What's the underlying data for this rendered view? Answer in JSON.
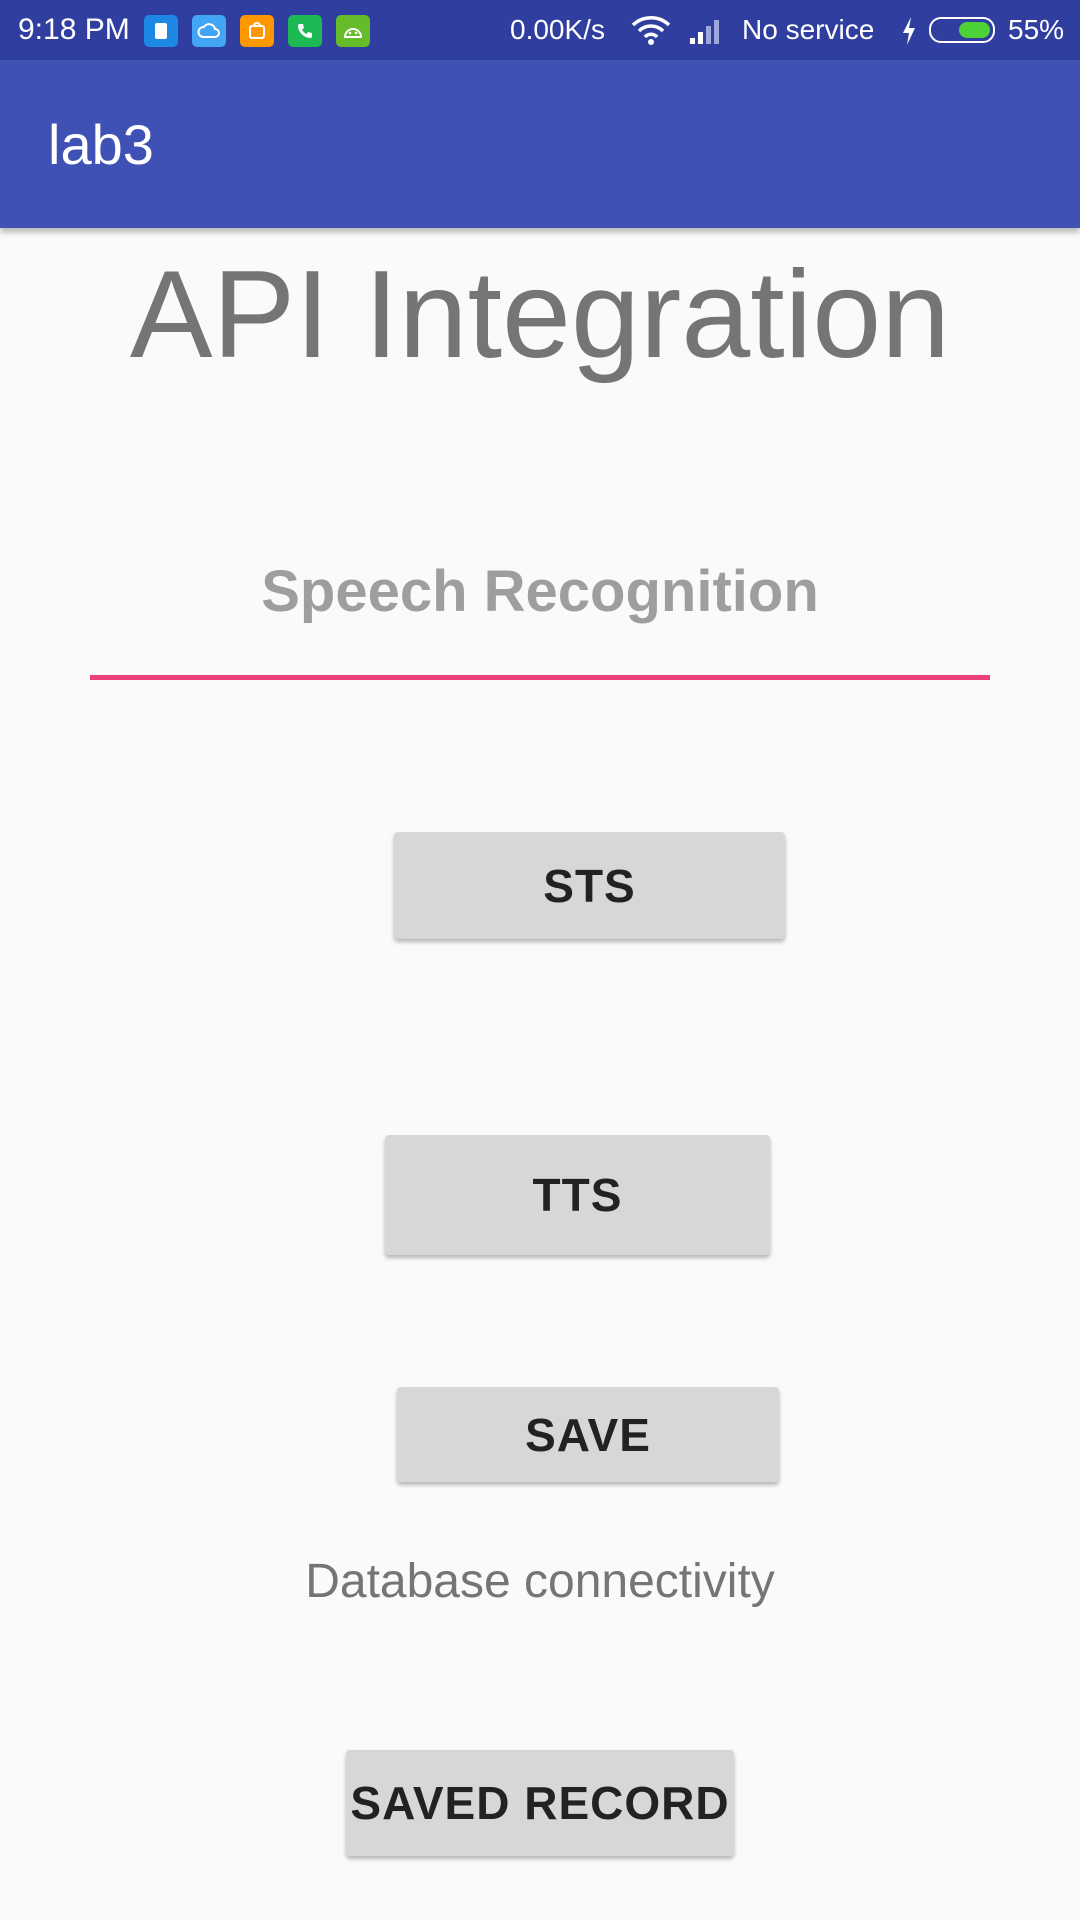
{
  "status_bar": {
    "time": "9:18 PM",
    "network_speed": "0.00K/s",
    "carrier": "No service",
    "battery_percent": "55%",
    "battery_level": 0.55,
    "notification_icons": [
      "sim-manager-icon",
      "cloud-icon",
      "mi-store-icon",
      "phone-icon",
      "android-icon"
    ]
  },
  "app_bar": {
    "title": "lab3"
  },
  "main": {
    "heading": "API Integration",
    "speech_field": {
      "placeholder": "Speech Recognition",
      "value": ""
    },
    "buttons": {
      "sts": "STS",
      "tts": "TTS",
      "save": "SAVE",
      "saved_record": "SAVED RECORD"
    },
    "database_caption": "Database connectivity"
  },
  "colors": {
    "status_bar_bg": "#303f9f",
    "app_bar_bg": "#3f51b5",
    "accent": "#ec407a",
    "button_bg": "#d6d7d7",
    "page_bg": "#fafafa"
  }
}
